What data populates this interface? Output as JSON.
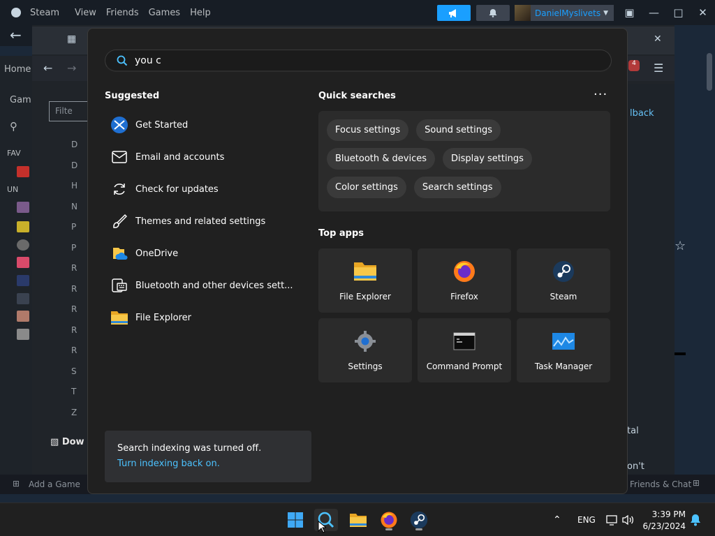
{
  "steam": {
    "brand": "Steam",
    "menu": [
      "View",
      "Friends",
      "Games",
      "Help"
    ],
    "username": "DanielMyslivets",
    "nav_home": "Home",
    "games_tab": "Gam",
    "filter_placeholder": "Filte",
    "favorites": "FAV",
    "uncategorized": "UN",
    "add_game": "Add a Game",
    "downloads": "Dow",
    "feedback_peek": "lback",
    "friends_chat": "Friends & Chat",
    "peek_tal": "tal",
    "peek_dont": "on't",
    "notif_badge": "4",
    "list_letters": [
      "D",
      "D",
      "H",
      "N",
      "P",
      "P",
      "R",
      "R",
      "R",
      "R",
      "R",
      "S",
      "T",
      "Z"
    ]
  },
  "search": {
    "query": "you c",
    "suggested_title": "Suggested",
    "suggested": [
      {
        "label": "Get Started",
        "icon": "get-started-icon"
      },
      {
        "label": "Email and accounts",
        "icon": "email-icon"
      },
      {
        "label": "Check for updates",
        "icon": "refresh-icon"
      },
      {
        "label": "Themes and related settings",
        "icon": "brush-icon"
      },
      {
        "label": "OneDrive",
        "icon": "onedrive-icon"
      },
      {
        "label": "Bluetooth and other devices sett...",
        "icon": "keyboard-icon"
      },
      {
        "label": "File Explorer",
        "icon": "folder-icon"
      }
    ],
    "quick_title": "Quick searches",
    "quick_searches": [
      "Focus settings",
      "Sound settings",
      "Bluetooth & devices",
      "Display settings",
      "Color settings",
      "Search settings"
    ],
    "top_apps_title": "Top apps",
    "top_apps": [
      {
        "label": "File Explorer",
        "icon": "file-explorer-icon"
      },
      {
        "label": "Firefox",
        "icon": "firefox-icon"
      },
      {
        "label": "Steam",
        "icon": "steam-icon"
      },
      {
        "label": "Settings",
        "icon": "settings-gear-icon"
      },
      {
        "label": "Command Prompt",
        "icon": "command-prompt-icon"
      },
      {
        "label": "Task Manager",
        "icon": "task-manager-icon"
      }
    ],
    "indexing_message": "Search indexing was turned off.",
    "indexing_link": "Turn indexing back on."
  },
  "taskbar": {
    "language": "ENG",
    "time": "3:39 PM",
    "date": "6/23/2024"
  },
  "colors": {
    "accent_blue": "#4cc2ff",
    "steam_blue": "#1a9fff",
    "panel_bg": "#202020"
  }
}
